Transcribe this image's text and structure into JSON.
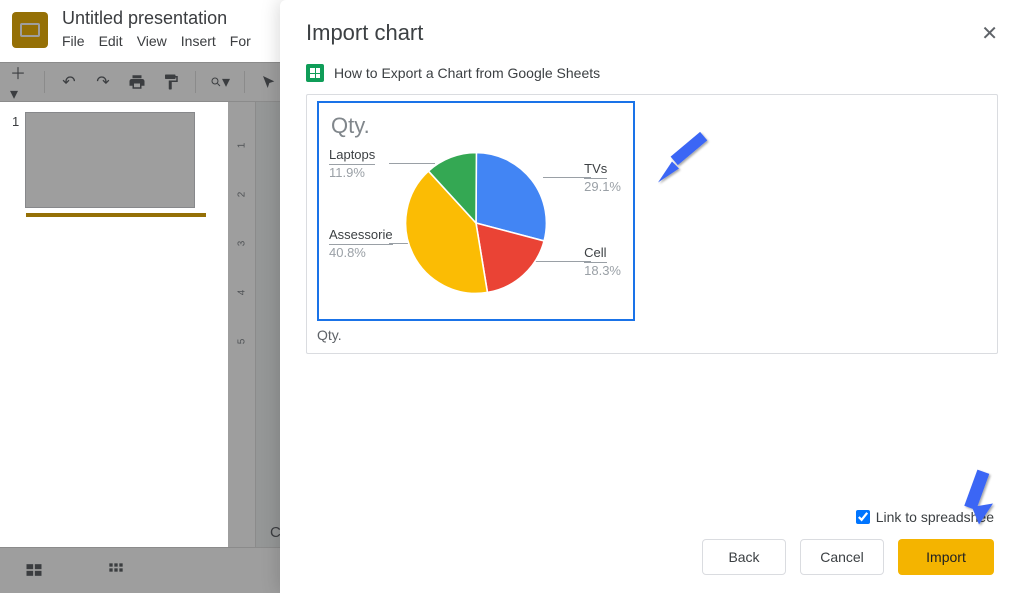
{
  "app": {
    "doc_title": "Untitled presentation",
    "menus": [
      "File",
      "Edit",
      "View",
      "Insert",
      "For"
    ],
    "slide_number": "1",
    "ruler_marks": [
      "1",
      "",
      "2",
      "",
      "3",
      "",
      "4",
      "",
      "5"
    ],
    "canvas_hint": "Click"
  },
  "dialog": {
    "title": "Import chart",
    "source_file": "How to Export a Chart from Google Sheets",
    "chart_caption": "Qty.",
    "link_label": "Link to spreadshee",
    "link_checked": true,
    "buttons": {
      "back": "Back",
      "cancel": "Cancel",
      "import": "Import"
    }
  },
  "chart_data": {
    "type": "pie",
    "title": "Qty.",
    "categories": [
      "TVs",
      "Cell",
      "Assessorie",
      "Laptops"
    ],
    "values_pct": [
      29.1,
      18.3,
      40.8,
      11.9
    ],
    "colors": [
      "#4285f4",
      "#ea4335",
      "#fbbc04",
      "#34a853"
    ],
    "labels": {
      "TVs": "29.1%",
      "Cell": "18.3%",
      "Assessorie": "40.8%",
      "Laptops": "11.9%"
    }
  }
}
